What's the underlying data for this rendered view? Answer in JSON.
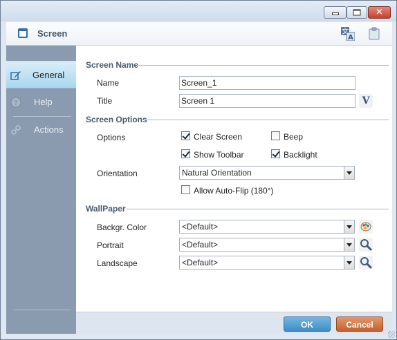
{
  "window": {
    "title": "Screen"
  },
  "sidebar": {
    "items": [
      {
        "label": "General",
        "icon": "edit-icon",
        "active": true
      },
      {
        "label": "Help",
        "icon": "help-icon",
        "active": false
      },
      {
        "label": "Actions",
        "icon": "actions-icon",
        "active": false
      }
    ]
  },
  "screen_name": {
    "section_label": "Screen Name",
    "name_label": "Name",
    "name_value": "Screen_1",
    "title_label": "Title",
    "title_value": "Screen 1",
    "title_button": "V"
  },
  "screen_options": {
    "section_label": "Screen Options",
    "options_label": "Options",
    "clear_screen": {
      "label": "Clear Screen",
      "checked": true
    },
    "beep": {
      "label": "Beep",
      "checked": false
    },
    "show_toolbar": {
      "label": "Show Toolbar",
      "checked": true
    },
    "backlight": {
      "label": "Backlight",
      "checked": true
    },
    "orientation_label": "Orientation",
    "orientation_value": "Natural Orientation",
    "auto_flip": {
      "label": "Allow Auto-Flip (180°)",
      "checked": false
    }
  },
  "wallpaper": {
    "section_label": "WallPaper",
    "backgr_color_label": "Backgr. Color",
    "backgr_color_value": "<Default>",
    "portrait_label": "Portrait",
    "portrait_value": "<Default>",
    "landscape_label": "Landscape",
    "landscape_value": "<Default>"
  },
  "footer": {
    "ok_label": "OK",
    "cancel_label": "Cancel"
  },
  "colors": {
    "accent_ok": "#4a97cc",
    "accent_cancel": "#cf6d39",
    "sidebar": "#8a9bb0"
  }
}
